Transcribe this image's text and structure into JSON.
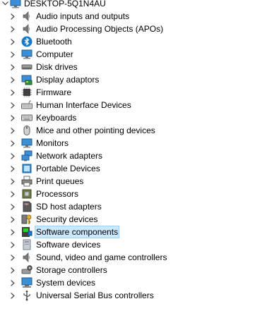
{
  "root": {
    "label": "DESKTOP-5Q1N4AU",
    "icon": "computer-icon",
    "expanded": true
  },
  "items": [
    {
      "label": "Audio inputs and outputs",
      "icon": "speaker-icon",
      "selected": false
    },
    {
      "label": "Audio Processing Objects (APOs)",
      "icon": "speaker-icon",
      "selected": false
    },
    {
      "label": "Bluetooth",
      "icon": "bluetooth-icon",
      "selected": false
    },
    {
      "label": "Computer",
      "icon": "monitor-icon",
      "selected": false
    },
    {
      "label": "Disk drives",
      "icon": "disk-drive-icon",
      "selected": false
    },
    {
      "label": "Display adaptors",
      "icon": "display-adapter-icon",
      "selected": false
    },
    {
      "label": "Firmware",
      "icon": "chip-icon",
      "selected": false
    },
    {
      "label": "Human Interface Devices",
      "icon": "keyboard-hid-icon",
      "selected": false
    },
    {
      "label": "Keyboards",
      "icon": "keyboard-icon",
      "selected": false
    },
    {
      "label": "Mice and other pointing devices",
      "icon": "mouse-icon",
      "selected": false
    },
    {
      "label": "Monitors",
      "icon": "monitor-icon",
      "selected": false
    },
    {
      "label": "Network adapters",
      "icon": "network-icon",
      "selected": false
    },
    {
      "label": "Portable Devices",
      "icon": "portable-device-icon",
      "selected": false
    },
    {
      "label": "Print queues",
      "icon": "printer-icon",
      "selected": false
    },
    {
      "label": "Processors",
      "icon": "processor-icon",
      "selected": false
    },
    {
      "label": "SD host adapters",
      "icon": "sd-card-icon",
      "selected": false
    },
    {
      "label": "Security devices",
      "icon": "key-icon",
      "selected": false
    },
    {
      "label": "Software components",
      "icon": "software-component-icon",
      "selected": true
    },
    {
      "label": "Software devices",
      "icon": "software-device-icon",
      "selected": false
    },
    {
      "label": "Sound, video and game controllers",
      "icon": "speaker-icon",
      "selected": false
    },
    {
      "label": "Storage controllers",
      "icon": "storage-controller-icon",
      "selected": false
    },
    {
      "label": "System devices",
      "icon": "system-device-icon",
      "selected": false
    },
    {
      "label": "Universal Serial Bus controllers",
      "icon": "usb-icon",
      "selected": false
    }
  ],
  "colors": {
    "selection_fill": "#cce8ff",
    "selection_border": "#99d1ff",
    "expander": "#404040",
    "icon_blue": "#1e78c8"
  }
}
